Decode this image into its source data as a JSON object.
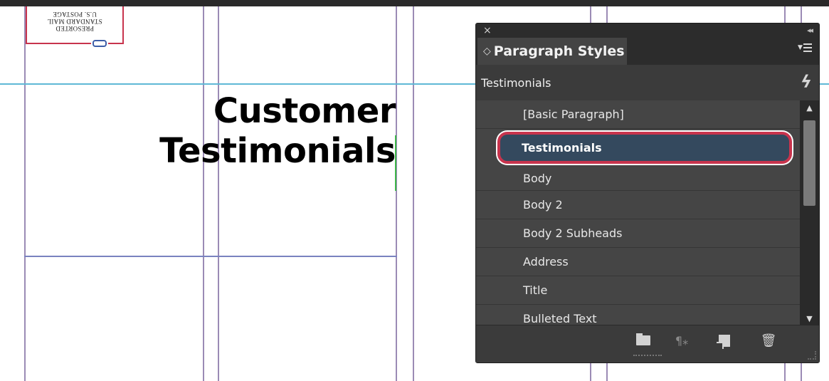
{
  "document": {
    "headline_line1": "Customer",
    "headline_line2": "Testimonials",
    "stamp_text": [
      "PRESORTED",
      "STANDARD MAIL",
      "U.S. POSTAGE"
    ]
  },
  "panel": {
    "close_glyph": "×",
    "collapse_glyph": "◂◂",
    "tab_label": "Paragraph Styles",
    "current_style": "Testimonials",
    "styles": [
      {
        "label": "[Basic Paragraph]",
        "selected": false
      },
      {
        "label": "Testimonials",
        "selected": true
      },
      {
        "label": "Body",
        "selected": false
      },
      {
        "label": "Body 2",
        "selected": false
      },
      {
        "label": "Body 2 Subheads",
        "selected": false
      },
      {
        "label": "Address",
        "selected": false
      },
      {
        "label": "Title",
        "selected": false
      },
      {
        "label": "Bulleted Text",
        "selected": false
      }
    ],
    "footer_icons": [
      "folder-icon",
      "clear-overrides-icon",
      "new-style-icon",
      "trash-icon"
    ],
    "accent_color": "#c8344d",
    "selected_color": "#34495e"
  }
}
